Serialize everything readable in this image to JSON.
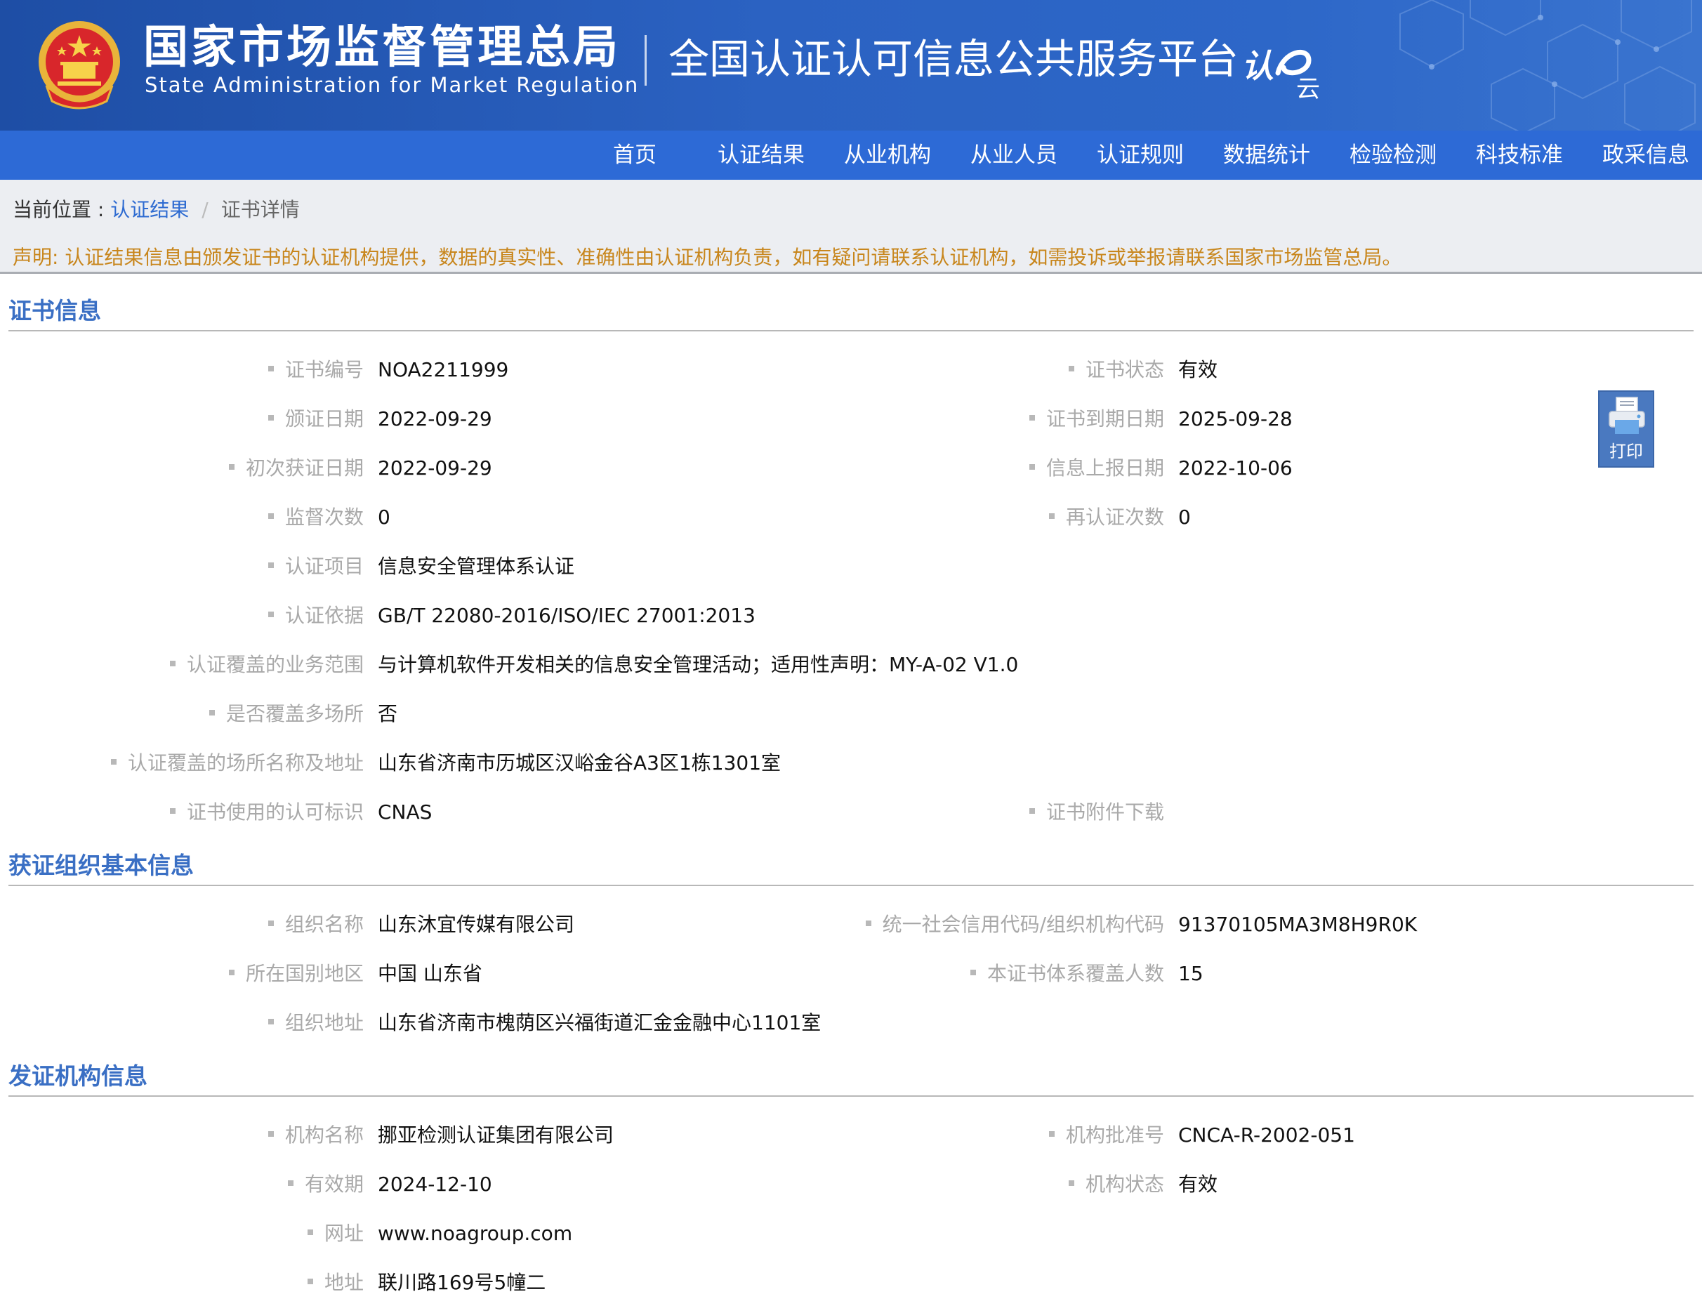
{
  "header": {
    "org_name_cn": "国家市场监督管理总局",
    "org_name_en": "State Administration  for  Market Regulation",
    "platform_title": "全国认证认可信息公共服务平台",
    "logo_text_main": "认e",
    "logo_text_sub": "云",
    "brand_color": "#2d6ad6",
    "emblem_icon": "national-emblem-icon"
  },
  "nav": {
    "items": [
      {
        "label": "首页"
      },
      {
        "label": "认证结果"
      },
      {
        "label": "从业机构"
      },
      {
        "label": "从业人员"
      },
      {
        "label": "认证规则"
      },
      {
        "label": "数据统计"
      },
      {
        "label": "检验检测"
      },
      {
        "label": "科技标准"
      },
      {
        "label": "政采信息"
      }
    ]
  },
  "breadcrumb": {
    "prefix": "当前位置 : ",
    "link": "认证结果",
    "separator": "/",
    "current": "证书详情"
  },
  "notice": "声明: 认证结果信息由颁发证书的认证机构提供，数据的真实性、准确性由认证机构负责，如有疑问请联系认证机构，如需投诉或举报请联系国家市场监管总局。",
  "print_button": {
    "label": "打印",
    "icon": "printer-icon"
  },
  "cert_section": {
    "title": "证书信息",
    "fields": {
      "cert_no": {
        "label": "证书编号",
        "value": "NOA2211999"
      },
      "cert_status": {
        "label": "证书状态",
        "value": "有效"
      },
      "issue_date": {
        "label": "颁证日期",
        "value": "2022-09-29"
      },
      "expiry_date": {
        "label": "证书到期日期",
        "value": "2025-09-28"
      },
      "first_date": {
        "label": "初次获证日期",
        "value": "2022-09-29"
      },
      "report_date": {
        "label": "信息上报日期",
        "value": "2022-10-06"
      },
      "supervision_count": {
        "label": "监督次数",
        "value": "0"
      },
      "recert_count": {
        "label": "再认证次数",
        "value": "0"
      },
      "cert_item": {
        "label": "认证项目",
        "value": "信息安全管理体系认证"
      },
      "cert_basis": {
        "label": "认证依据",
        "value": "GB/T 22080-2016/ISO/IEC 27001:2013"
      },
      "scope": {
        "label": "认证覆盖的业务范围",
        "value": "与计算机软件开发相关的信息安全管理活动；适用性声明：MY-A-02 V1.0"
      },
      "multi_site": {
        "label": "是否覆盖多场所",
        "value": "否"
      },
      "site_address": {
        "label": "认证覆盖的场所名称及地址",
        "value": "山东省济南市历城区汉峪金谷A3区1栋1301室"
      },
      "accreditation_mark": {
        "label": "证书使用的认可标识",
        "value": "CNAS"
      },
      "attachment": {
        "label": "证书附件下载",
        "value": ""
      }
    }
  },
  "org_section": {
    "title": "获证组织基本信息",
    "fields": {
      "org_name": {
        "label": "组织名称",
        "value": "山东沐宜传媒有限公司"
      },
      "credit_code": {
        "label": "统一社会信用代码/组织机构代码",
        "value": "91370105MA3M8H9R0K"
      },
      "region": {
        "label": "所在国别地区",
        "value": "中国 山东省"
      },
      "covered_people": {
        "label": "本证书体系覆盖人数",
        "value": "15"
      },
      "org_address": {
        "label": "组织地址",
        "value": "山东省济南市槐荫区兴福街道汇金金融中心1101室"
      }
    }
  },
  "body_section": {
    "title": "发证机构信息",
    "fields": {
      "body_name": {
        "label": "机构名称",
        "value": "挪亚检测认证集团有限公司"
      },
      "approval_no": {
        "label": "机构批准号",
        "value": "CNCA-R-2002-051"
      },
      "validity": {
        "label": "有效期",
        "value": "2024-12-10"
      },
      "body_status": {
        "label": "机构状态",
        "value": "有效"
      },
      "website": {
        "label": "网址",
        "value": "www.noagroup.com"
      },
      "address": {
        "label": "地址",
        "value": "联川路169号5幢二"
      }
    }
  }
}
